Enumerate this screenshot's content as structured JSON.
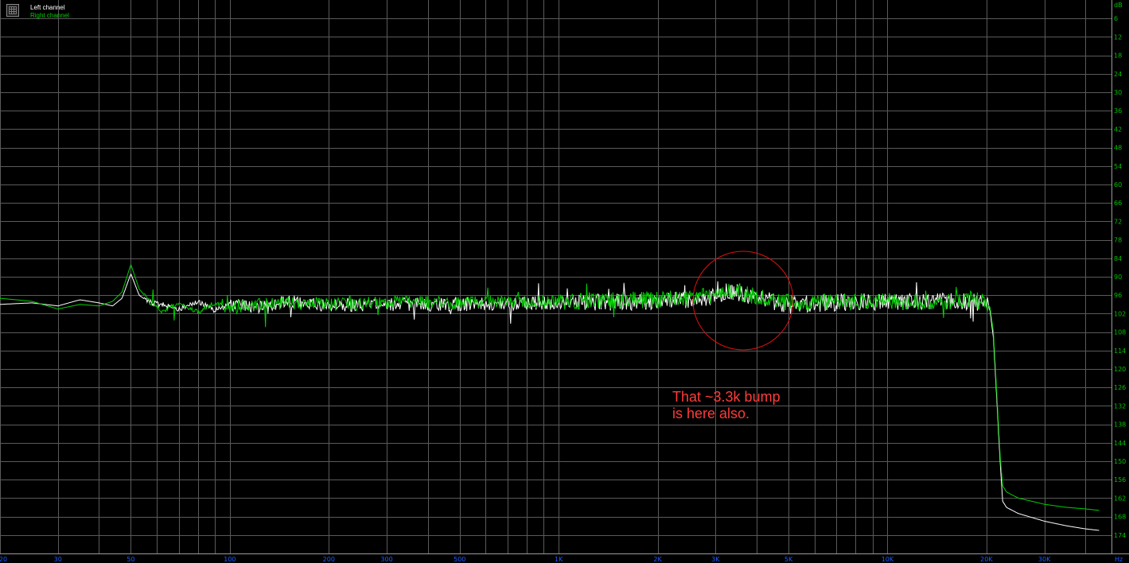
{
  "legend": {
    "entries": [
      {
        "label": "Left channel",
        "color": "#ffffff"
      },
      {
        "label": "Right channel",
        "color": "#00d000"
      }
    ]
  },
  "annotation": {
    "text": "That ~3.3k bump\nis here also.",
    "color": "#ff3b3b"
  },
  "chart_data": {
    "type": "line",
    "xscale": "log",
    "xlim": [
      20,
      48000
    ],
    "ylim": [
      0,
      -180
    ],
    "grid": true,
    "yunit": "dB",
    "xunit": "Hz",
    "ytick_color": "#00c000",
    "xtick_color": "#1e5dff",
    "ytick_labels": [
      "6",
      "12",
      "18",
      "24",
      "30",
      "36",
      "42",
      "48",
      "54",
      "60",
      "66",
      "72",
      "78",
      "84",
      "90",
      "96",
      "102",
      "108",
      "114",
      "120",
      "126",
      "132",
      "138",
      "144",
      "150",
      "156",
      "162",
      "168",
      "174"
    ],
    "xtick_labels": [
      "20",
      "30",
      "50",
      "100",
      "200",
      "300",
      "500",
      "1K",
      "2K",
      "3K",
      "5K",
      "10K",
      "20K",
      "30K"
    ],
    "xtick_values": [
      20,
      30,
      50,
      100,
      200,
      300,
      500,
      1000,
      2000,
      3000,
      5000,
      10000,
      20000,
      30000
    ],
    "series": [
      {
        "name": "Left channel",
        "color": "#ffffff",
        "points": [
          [
            20,
            -99.0
          ],
          [
            25,
            -98.5
          ],
          [
            30,
            -99.5
          ],
          [
            35,
            -97.5
          ],
          [
            40,
            -98.5
          ],
          [
            44,
            -99.5
          ],
          [
            47,
            -97.0
          ],
          [
            50,
            -89.0
          ],
          [
            53,
            -96.0
          ],
          [
            57,
            -98.5
          ],
          [
            62,
            -99.0
          ],
          [
            70,
            -100.5
          ],
          [
            80,
            -98.0
          ],
          [
            90,
            -101.0
          ],
          [
            100,
            -99.0
          ],
          [
            120,
            -100.0
          ],
          [
            150,
            -98.0
          ],
          [
            200,
            -99.5
          ],
          [
            300,
            -99.0
          ],
          [
            500,
            -99.0
          ],
          [
            1000,
            -98.5
          ],
          [
            2000,
            -98.0
          ],
          [
            2500,
            -97.5
          ],
          [
            3000,
            -96.5
          ],
          [
            3300,
            -94.5
          ],
          [
            3600,
            -95.5
          ],
          [
            4000,
            -97.0
          ],
          [
            5000,
            -99.0
          ],
          [
            7000,
            -98.5
          ],
          [
            10000,
            -98.0
          ],
          [
            15000,
            -98.0
          ],
          [
            18000,
            -98.0
          ],
          [
            20000,
            -98.5
          ],
          [
            20500,
            -101.0
          ],
          [
            21000,
            -110.0
          ],
          [
            21500,
            -130.0
          ],
          [
            22000,
            -150.0
          ],
          [
            22400,
            -163.0
          ],
          [
            23000,
            -165.0
          ],
          [
            25000,
            -167.0
          ],
          [
            30000,
            -169.5
          ],
          [
            35000,
            -171.0
          ],
          [
            40000,
            -172.0
          ],
          [
            44000,
            -172.5
          ]
        ]
      },
      {
        "name": "Right channel",
        "color": "#00d000",
        "points": [
          [
            20,
            -97.0
          ],
          [
            25,
            -98.0
          ],
          [
            30,
            -100.5
          ],
          [
            35,
            -99.0
          ],
          [
            40,
            -99.5
          ],
          [
            44,
            -98.0
          ],
          [
            47,
            -95.0
          ],
          [
            50,
            -86.0
          ],
          [
            53,
            -94.0
          ],
          [
            57,
            -98.0
          ],
          [
            62,
            -101.0
          ],
          [
            70,
            -99.0
          ],
          [
            80,
            -101.5
          ],
          [
            90,
            -98.5
          ],
          [
            100,
            -100.0
          ],
          [
            120,
            -99.0
          ],
          [
            150,
            -98.5
          ],
          [
            200,
            -99.0
          ],
          [
            300,
            -98.5
          ],
          [
            500,
            -98.5
          ],
          [
            1000,
            -98.0
          ],
          [
            2000,
            -97.5
          ],
          [
            2500,
            -97.0
          ],
          [
            3000,
            -96.0
          ],
          [
            3300,
            -94.0
          ],
          [
            3600,
            -95.0
          ],
          [
            4000,
            -96.5
          ],
          [
            5000,
            -98.5
          ],
          [
            7000,
            -98.0
          ],
          [
            10000,
            -98.0
          ],
          [
            15000,
            -98.0
          ],
          [
            18000,
            -97.5
          ],
          [
            20000,
            -98.0
          ],
          [
            20500,
            -100.0
          ],
          [
            21000,
            -108.0
          ],
          [
            21500,
            -128.0
          ],
          [
            22000,
            -148.0
          ],
          [
            22400,
            -158.0
          ],
          [
            23000,
            -160.0
          ],
          [
            25000,
            -162.0
          ],
          [
            30000,
            -164.0
          ],
          [
            35000,
            -165.0
          ],
          [
            40000,
            -165.5
          ],
          [
            44000,
            -166.0
          ]
        ]
      }
    ]
  }
}
